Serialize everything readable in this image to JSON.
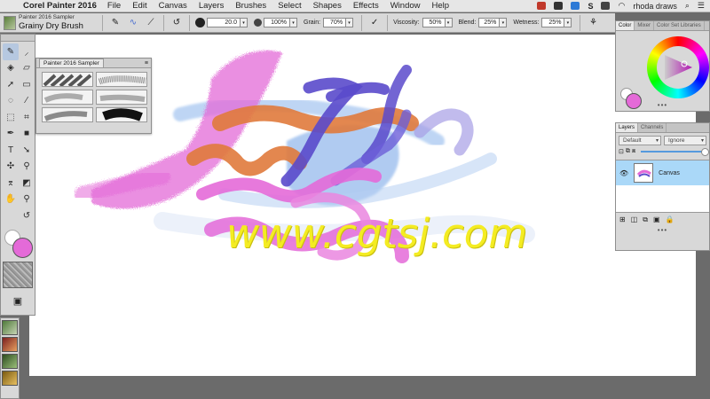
{
  "menubar": {
    "app_name": "Corel Painter 2016",
    "items": [
      "File",
      "Edit",
      "Canvas",
      "Layers",
      "Brushes",
      "Select",
      "Shapes",
      "Effects",
      "Window",
      "Help"
    ],
    "user": "rhoda draws"
  },
  "propbar": {
    "brush_category": "Painter 2016 Sampler",
    "brush_variant": "Grainy Dry Brush",
    "size_value": "20.0",
    "opacity_value": "100%",
    "grain_label": "Grain:",
    "grain_value": "70%",
    "viscosity_label": "Viscosity:",
    "viscosity_value": "50%",
    "blend_label": "Blend:",
    "blend_value": "25%",
    "wetness_label": "Wetness:",
    "wetness_value": "25%"
  },
  "sampler": {
    "title": "Painter 2016 Sampler"
  },
  "color_panel": {
    "tabs": [
      "Color",
      "Mixer",
      "Color Set Libraries"
    ],
    "main_color": "#e46ad8",
    "additional_color": "#ffffff"
  },
  "layers_panel": {
    "tabs": [
      "Layers",
      "Channels"
    ],
    "composite_method": "Default",
    "composite_depth": "Ignore",
    "layer_name": "Canvas"
  },
  "watermark": {
    "text": "www.cgtsj.com"
  },
  "colors": {
    "pink": "#e46ad8",
    "orange": "#e07a3c",
    "violet": "#5a4acb",
    "light_blue": "#8fb6ec",
    "watermark": "#f4ec22"
  }
}
